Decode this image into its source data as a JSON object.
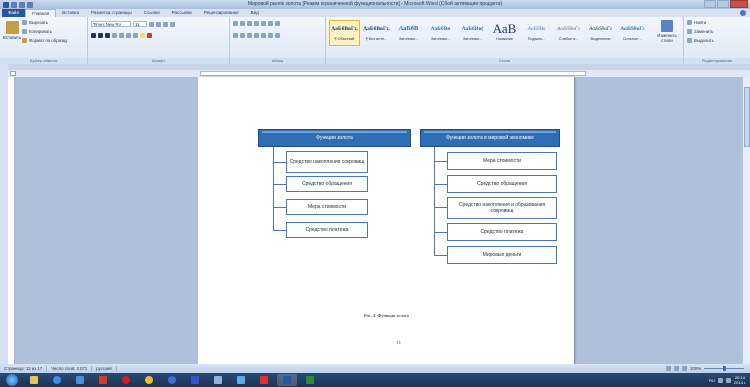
{
  "window": {
    "title": "Мировой рынок золота [Режим ограниченной функциональности] - Microsoft Word (Сбой активации продукта)"
  },
  "tabs": [
    "Файл",
    "Главная",
    "Вставка",
    "Разметка страницы",
    "Ссылки",
    "Рассылки",
    "Рецензирование",
    "Вид"
  ],
  "ribbon": {
    "clipboard": {
      "paste": "Вставить",
      "cut": "Вырезать",
      "copy": "Копировать",
      "format_painter": "Формат по образцу",
      "label": "Буфер обмена"
    },
    "font": {
      "name": "Times New Ro",
      "size": "11",
      "label": "Шрифт"
    },
    "paragraph": {
      "label": "Абзац"
    },
    "styles": {
      "items": [
        {
          "sample": "АаБбВвГг,",
          "name": "¶ Обычный"
        },
        {
          "sample": "АаБбВвГг,",
          "name": "¶ Без инте..."
        },
        {
          "sample": "АаБбВ",
          "name": "Заголово..."
        },
        {
          "sample": "АаБбВв",
          "name": "Заголово..."
        },
        {
          "sample": "АаБбВв(",
          "name": "Заголово..."
        },
        {
          "sample": "АаВ",
          "name": "Название"
        },
        {
          "sample": "АаБбВв",
          "name": "Подзаго..."
        },
        {
          "sample": "АаБбВвГг",
          "name": "Слабое в..."
        },
        {
          "sample": "АаБбВвГг",
          "name": "Выделение"
        },
        {
          "sample": "АаБбВвГг",
          "name": "Сильное ..."
        }
      ],
      "change_styles": "Изменить стили",
      "label": "Стили"
    },
    "editing": {
      "find": "Найти",
      "replace": "Заменить",
      "select": "Выделить",
      "label": "Редактирование"
    }
  },
  "document": {
    "left_diagram": {
      "header": "Функции золота",
      "items": [
        "Средство накопления сокровищ",
        "Средство обращения",
        "Мера стоимости",
        "Средство платежа"
      ]
    },
    "right_diagram": {
      "header": "Функции золота в мировой экономике",
      "items": [
        "Мера стоимости",
        "Средство обращения",
        "Средство накопления и образования сокровищ",
        "Средство платежа",
        "Мировые деньги"
      ]
    },
    "caption": "Рис. 4. Функции золота",
    "page_number": "13"
  },
  "statusbar": {
    "page": "Страница: 12 из 17",
    "words": "Число слов: 3 071",
    "language": "русский",
    "zoom": "100%"
  },
  "taskbar": {
    "lang": "RU",
    "time": "20:14",
    "date": "2014 г."
  },
  "colors": {
    "accent": "#2f6db5",
    "ribbon": "#dde8f5",
    "taskbar": "#183356"
  }
}
